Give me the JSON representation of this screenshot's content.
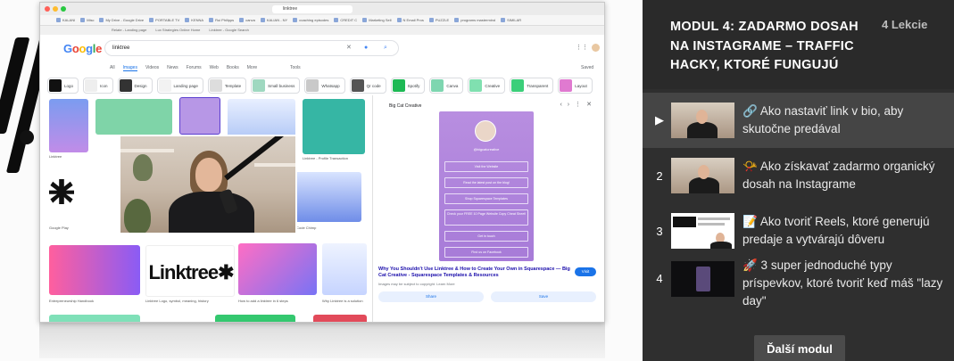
{
  "browser": {
    "url": "linktree",
    "bookmarks": [
      "KALANI",
      "Misc",
      "My Drive - Google Drive",
      "PORTABLE TV",
      "KENNA",
      "Rui Philipps",
      "canva",
      "KALIAN - NY",
      "coaching episodes",
      "CREDIT C",
      "Marketing Sell",
      "N Email Pros",
      "PUZZLE",
      "programs mastermind",
      "SIMILAR"
    ],
    "tabs": [
      "Relate - Landing page",
      "Lux Strategies Online Home",
      "Linktree - Google Search"
    ]
  },
  "google": {
    "logo": "Google",
    "query": "linktree",
    "tabs": [
      "All",
      "Images",
      "Videos",
      "News",
      "Forums",
      "Web",
      "Books",
      "More"
    ],
    "active_tab": "Images",
    "tools": "Tools",
    "saved": "Saved",
    "chips": [
      "Logo",
      "Icon",
      "Design",
      "Landing page",
      "Template",
      "Small business",
      "Whatsapp",
      "Qr code",
      "Spotify",
      "Canva",
      "Creative",
      "Transparent",
      "Layout"
    ],
    "captions": {
      "c1": "Linktree",
      "c2": "Google Play",
      "c3": "Linktree",
      "c4": "Linktree Logo, symbol, meaning, history",
      "c5": "Linktree - Profile Transaction",
      "c6": "QR Code Chimp",
      "c7": "Entrepreneurship Handbook",
      "c8": "How to add a linktree in 6 steps",
      "c9": "Why Linktree is a solution"
    },
    "linktree_wordmark": "Linktree✱"
  },
  "preview": {
    "source": "Big Cat Creative",
    "handle": "@bigcatcreative",
    "buttons": [
      "Visit the Website",
      "Read the latest post on the blog!",
      "Shop Squarespace Templates",
      "Check your FREE 10 Page Website Copy Cheat Sheet!",
      "Get in touch",
      "Find us on Facebook"
    ],
    "title": "Why You Shouldn't Use Linktree & How to Create Your Own in Squarespace — Big Cat Creative - Squarespace Templates & Resources",
    "subtitle": "Images may be subject to copyright. Learn More",
    "visit": "Visit",
    "share": "Share",
    "save": "Save"
  },
  "playlist": {
    "module_title": "MODUL 4: ZADARMO DOSAH NA INSTAGRAME – TRAFFIC HACKY, KTORÉ FUNGUJÚ",
    "lesson_count": "4 Lekcie",
    "lessons": [
      {
        "num": "▶",
        "title": "🔗 Ako nastaviť link v bio, aby skutočne predával",
        "active": true
      },
      {
        "num": "2",
        "title": "📯 Ako získavať zadarmo organický dosah na Instagrame",
        "active": false
      },
      {
        "num": "3",
        "title": "📝 Ako tvoriť Reels, ktoré generujú predaje a vytvárajú dôveru",
        "active": false
      },
      {
        "num": "4",
        "title": "🚀 3 super jednoduché typy príspevkov, ktoré tvoriť keď máš \"lazy day\"",
        "active": false
      }
    ],
    "next_module": "Ďalší modul"
  },
  "colors": {
    "sidebar_bg": "#2f2f2f",
    "active_row_bg": "#454545",
    "phone_purple": "#a77bd8",
    "google_blue": "#1a73e8"
  }
}
